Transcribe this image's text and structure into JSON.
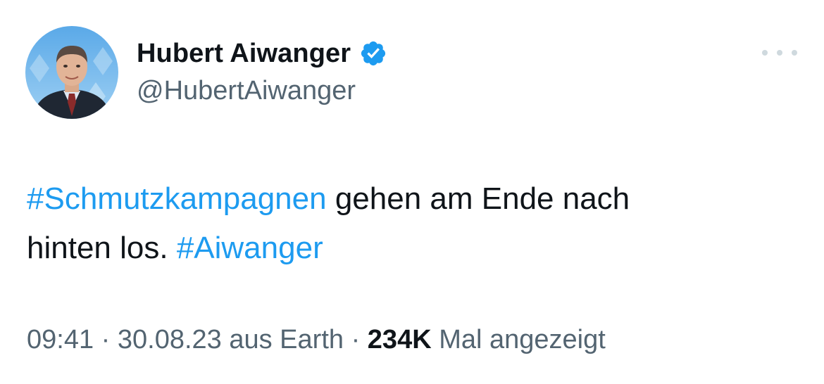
{
  "author": {
    "display_name": "Hubert Aiwanger",
    "handle": "@HubertAiwanger",
    "verified_icon": "verified-badge-icon",
    "avatar_icon": "profile-photo"
  },
  "more_icon": "more-options-icon",
  "tweet": {
    "hashtag_1": "#Schmutzkampagnen",
    "text_1": " gehen am Ende nach",
    "text_2": "hinten los. ",
    "hashtag_2": "#Aiwanger"
  },
  "meta": {
    "time": "09:41",
    "sep_1": " · ",
    "date": "30.08.23",
    "source": " aus Earth",
    "sep_2": " · ",
    "views_count": "234K",
    "views_label": " Mal angezeigt"
  },
  "colors": {
    "accent": "#1d9bf0",
    "text": "#0f1419",
    "secondary": "#536471"
  }
}
